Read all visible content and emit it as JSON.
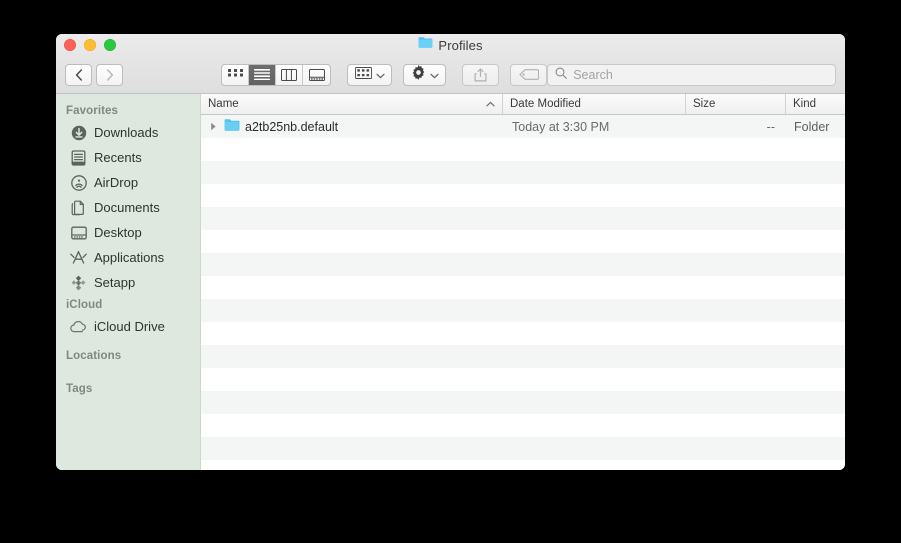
{
  "window": {
    "title": "Profiles",
    "title_icon": "folder-icon",
    "traffic_lights": [
      {
        "name": "close",
        "color": "#ff5f57"
      },
      {
        "name": "minimize",
        "color": "#febc2e"
      },
      {
        "name": "zoom",
        "color": "#28c840"
      }
    ]
  },
  "toolbar": {
    "back_label": "‹",
    "forward_label": "›",
    "view_modes": [
      {
        "name": "icon-view",
        "icon": "grid-icon",
        "active": false
      },
      {
        "name": "list-view",
        "icon": "list-icon",
        "active": true
      },
      {
        "name": "column-view",
        "icon": "columns-icon",
        "active": false
      },
      {
        "name": "gallery-view",
        "icon": "gallery-icon",
        "active": false
      }
    ],
    "arrange_icon": "group-grid-icon",
    "action_icon": "gear-icon",
    "share_icon": "share-icon",
    "tags_icon": "tag-icon",
    "chevron_icon": "chevron-down-icon"
  },
  "search": {
    "placeholder": "Search",
    "value": "",
    "icon": "search-icon"
  },
  "sidebar": {
    "sections": [
      {
        "header": "Favorites",
        "items": [
          {
            "label": "Downloads",
            "icon": "download-circle-icon"
          },
          {
            "label": "Recents",
            "icon": "clock-document-icon"
          },
          {
            "label": "AirDrop",
            "icon": "airdrop-icon"
          },
          {
            "label": "Documents",
            "icon": "documents-icon"
          },
          {
            "label": "Desktop",
            "icon": "desktop-icon"
          },
          {
            "label": "Applications",
            "icon": "applications-icon"
          },
          {
            "label": "Setapp",
            "icon": "setapp-icon"
          }
        ]
      },
      {
        "header": "iCloud",
        "items": [
          {
            "label": "iCloud Drive",
            "icon": "cloud-icon"
          }
        ]
      },
      {
        "header": "Locations",
        "items": []
      },
      {
        "header": "Tags",
        "items": []
      }
    ]
  },
  "filelist": {
    "columns": [
      {
        "label": "Name",
        "sorted": true,
        "sort_dir": "asc"
      },
      {
        "label": "Date Modified",
        "sorted": false
      },
      {
        "label": "Size",
        "sorted": false
      },
      {
        "label": "Kind",
        "sorted": false
      }
    ],
    "rows": [
      {
        "name": "a2tb25nb.default",
        "date_modified": "Today at 3:30 PM",
        "size": "--",
        "kind": "Folder",
        "icon": "folder-icon",
        "expandable": true
      }
    ],
    "empty_row_count": 14
  },
  "colors": {
    "sidebar_bg": "#dfe8df",
    "stripe": "#f4f5f5",
    "folder_blue": "#5bc8f5",
    "desktop_bg": "#000000"
  }
}
